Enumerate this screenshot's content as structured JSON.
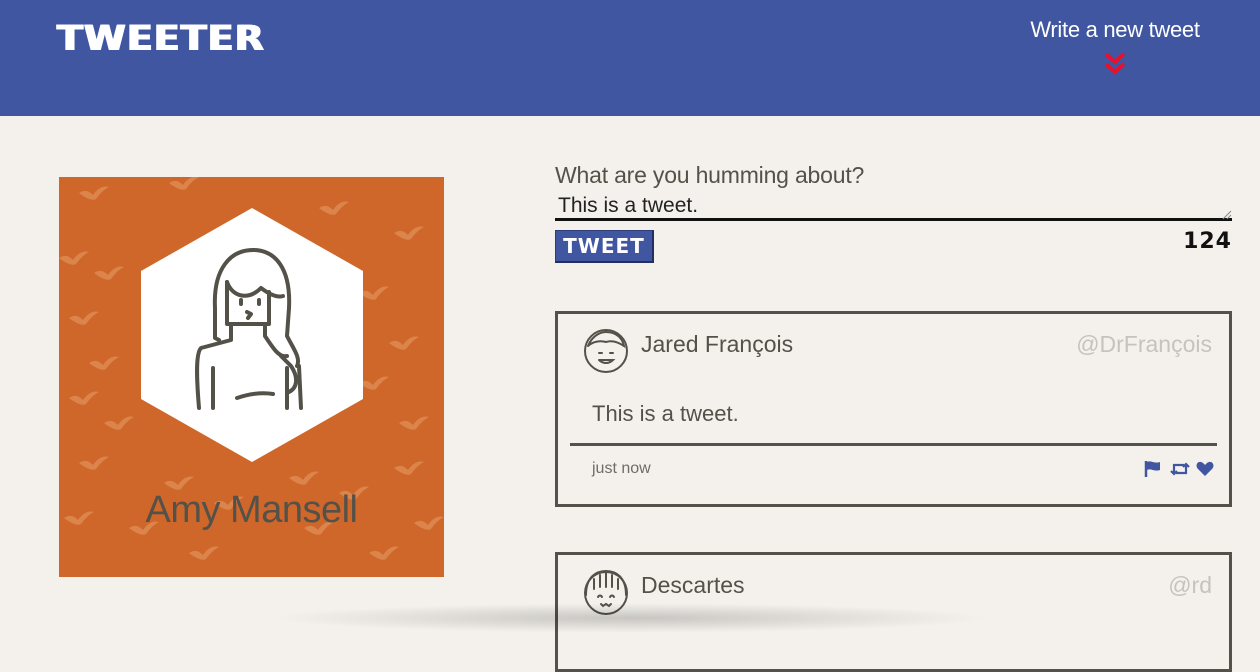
{
  "nav": {
    "logo": "TWEETER",
    "compose_toggle_label": "Write a new tweet",
    "compose_toggle_icon": "double-chevron-down-icon",
    "accent_color": "#e8112d",
    "background_color": "#4056a1"
  },
  "profile": {
    "name": "Amy Mansell",
    "background_color": "#d0672a",
    "avatar_icon": "user-avatar-long-hair-icon"
  },
  "compose": {
    "label": "What are you humming about?",
    "input_value": "This is a tweet.",
    "submit_label": "TWEET",
    "char_counter": "124"
  },
  "tweets": [
    {
      "display_name": "Jared François",
      "handle": "@DrFrançois",
      "content": "This is a tweet.",
      "timestamp": "just now",
      "actions": [
        "flag-icon",
        "retweet-icon",
        "heart-icon"
      ]
    },
    {
      "display_name": "Descartes",
      "handle": "@rd"
    }
  ],
  "colors": {
    "page_background": "#f4f1ec",
    "text": "#545149",
    "action_icons": "#4056a1"
  }
}
